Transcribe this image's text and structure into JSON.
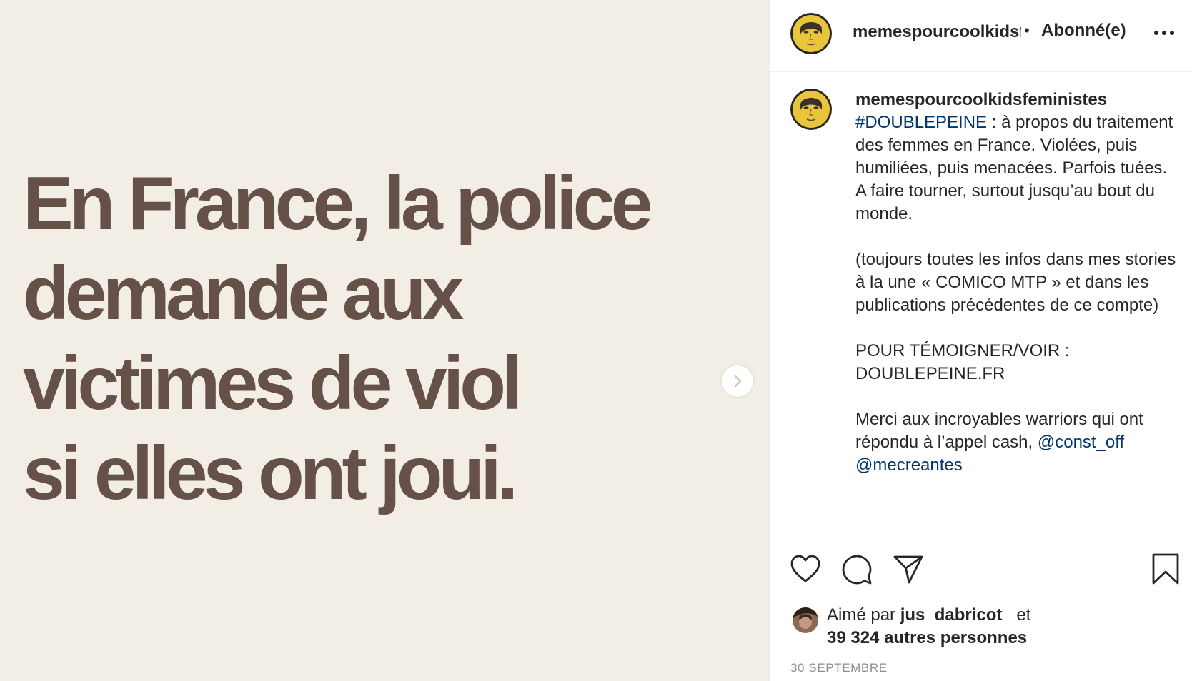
{
  "post": {
    "headline": "En France, la police\ndemande aux\nvictimes de viol\nsi elles ont joui."
  },
  "colors": {
    "image_background": "#f3eee5",
    "headline_text": "#665149",
    "link": "#00376b",
    "muted": "#8e8e8e",
    "avatar_yellow": "#e8c53a"
  },
  "header": {
    "username": "memespourcoolkidsfeministes",
    "separator": "•",
    "follow_status": "Abonné(e)",
    "more_icon": "more-horizontal-icon"
  },
  "caption": {
    "username": "memespourcoolkidsfeministes",
    "hashtag": "#DOUBLEPEINE",
    "para1_rest": " : à propos du traitement des femmes en France. Violées, puis humiliées, puis menacées. Parfois tuées. A faire tourner, surtout jusqu’au bout du monde.",
    "para2": "(toujours toutes les infos dans mes stories à la une « COMICO MTP » et dans les publications précédentes de ce compte)",
    "para3_line1": "POUR TÉMOIGNER/VOIR :",
    "para3_line2": "DOUBLEPEINE.FR",
    "para4_text": "Merci aux incroyables warriors qui ont répondu à l’appel cash, ",
    "mention1": "@const_off",
    "mention2": "@mecreantes"
  },
  "actions": {
    "like_icon": "heart-icon",
    "comment_icon": "comment-icon",
    "share_icon": "send-icon",
    "save_icon": "bookmark-icon"
  },
  "likes": {
    "prefix": "Aimé par ",
    "liker": "jus_dabricot_",
    "connector": " et",
    "others": "39 324 autres personnes"
  },
  "date": "30 SEPTEMBRE"
}
